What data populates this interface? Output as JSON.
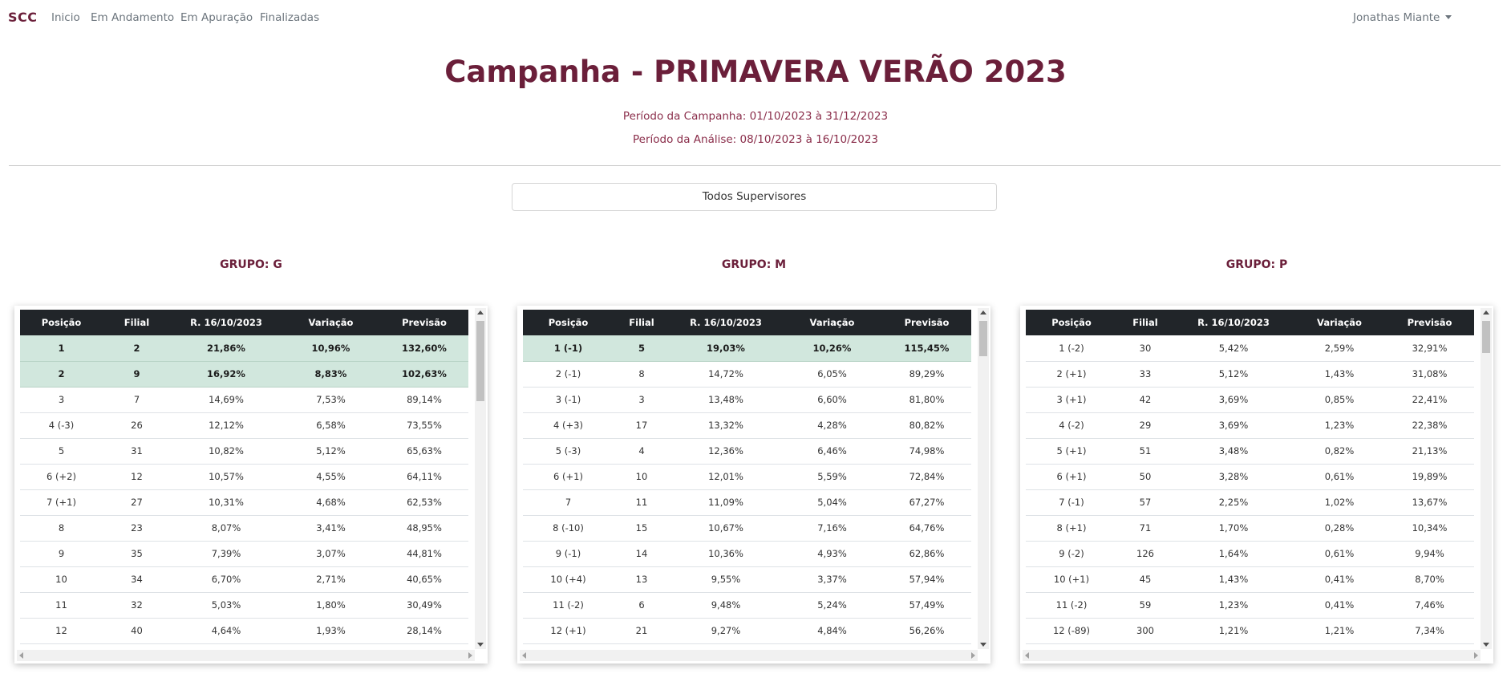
{
  "nav": {
    "brand": "SCC",
    "links": [
      "Inicio",
      "Em Andamento",
      "Em Apuração",
      "Finalizadas"
    ],
    "user": "Jonathas Miante"
  },
  "header": {
    "title": "Campanha - PRIMAVERA VERÃO 2023",
    "campaign_period": "Período da Campanha: 01/10/2023 à 31/12/2023",
    "analysis_period": "Período da Análise: 08/10/2023 à 16/10/2023"
  },
  "supervisor_select": {
    "label": "Todos Supervisores"
  },
  "colors": {
    "brand": "#6b1f3a",
    "table_header": "#212529",
    "highlight_row": "#d1e7dd"
  },
  "columns": [
    "Posição",
    "Filial",
    "R. 16/10/2023",
    "Variação",
    "Previsão"
  ],
  "groups": [
    {
      "title": "GRUPO: G",
      "rows": [
        {
          "pos": "1",
          "filial": "2",
          "r": "21,86%",
          "var": "10,96%",
          "prev": "132,60%",
          "highlight": true
        },
        {
          "pos": "2",
          "filial": "9",
          "r": "16,92%",
          "var": "8,83%",
          "prev": "102,63%",
          "highlight": true
        },
        {
          "pos": "3",
          "filial": "7",
          "r": "14,69%",
          "var": "7,53%",
          "prev": "89,14%"
        },
        {
          "pos": "4 (-3)",
          "filial": "26",
          "r": "12,12%",
          "var": "6,58%",
          "prev": "73,55%"
        },
        {
          "pos": "5",
          "filial": "31",
          "r": "10,82%",
          "var": "5,12%",
          "prev": "65,63%"
        },
        {
          "pos": "6 (+2)",
          "filial": "12",
          "r": "10,57%",
          "var": "4,55%",
          "prev": "64,11%"
        },
        {
          "pos": "7 (+1)",
          "filial": "27",
          "r": "10,31%",
          "var": "4,68%",
          "prev": "62,53%"
        },
        {
          "pos": "8",
          "filial": "23",
          "r": "8,07%",
          "var": "3,41%",
          "prev": "48,95%"
        },
        {
          "pos": "9",
          "filial": "35",
          "r": "7,39%",
          "var": "3,07%",
          "prev": "44,81%"
        },
        {
          "pos": "10",
          "filial": "34",
          "r": "6,70%",
          "var": "2,71%",
          "prev": "40,65%"
        },
        {
          "pos": "11",
          "filial": "32",
          "r": "5,03%",
          "var": "1,80%",
          "prev": "30,49%"
        },
        {
          "pos": "12",
          "filial": "40",
          "r": "4,64%",
          "var": "1,93%",
          "prev": "28,14%"
        }
      ]
    },
    {
      "title": "GRUPO: M",
      "rows": [
        {
          "pos": "1 (-1)",
          "filial": "5",
          "r": "19,03%",
          "var": "10,26%",
          "prev": "115,45%",
          "highlight": true
        },
        {
          "pos": "2 (-1)",
          "filial": "8",
          "r": "14,72%",
          "var": "6,05%",
          "prev": "89,29%"
        },
        {
          "pos": "3 (-1)",
          "filial": "3",
          "r": "13,48%",
          "var": "6,60%",
          "prev": "81,80%"
        },
        {
          "pos": "4 (+3)",
          "filial": "17",
          "r": "13,32%",
          "var": "4,28%",
          "prev": "80,82%"
        },
        {
          "pos": "5 (-3)",
          "filial": "4",
          "r": "12,36%",
          "var": "6,46%",
          "prev": "74,98%"
        },
        {
          "pos": "6 (+1)",
          "filial": "10",
          "r": "12,01%",
          "var": "5,59%",
          "prev": "72,84%"
        },
        {
          "pos": "7",
          "filial": "11",
          "r": "11,09%",
          "var": "5,04%",
          "prev": "67,27%"
        },
        {
          "pos": "8 (-10)",
          "filial": "15",
          "r": "10,67%",
          "var": "7,16%",
          "prev": "64,76%"
        },
        {
          "pos": "9 (-1)",
          "filial": "14",
          "r": "10,36%",
          "var": "4,93%",
          "prev": "62,86%"
        },
        {
          "pos": "10 (+4)",
          "filial": "13",
          "r": "9,55%",
          "var": "3,37%",
          "prev": "57,94%"
        },
        {
          "pos": "11 (-2)",
          "filial": "6",
          "r": "9,48%",
          "var": "5,24%",
          "prev": "57,49%"
        },
        {
          "pos": "12 (+1)",
          "filial": "21",
          "r": "9,27%",
          "var": "4,84%",
          "prev": "56,26%"
        }
      ]
    },
    {
      "title": "GRUPO: P",
      "rows": [
        {
          "pos": "1 (-2)",
          "filial": "30",
          "r": "5,42%",
          "var": "2,59%",
          "prev": "32,91%"
        },
        {
          "pos": "2 (+1)",
          "filial": "33",
          "r": "5,12%",
          "var": "1,43%",
          "prev": "31,08%"
        },
        {
          "pos": "3 (+1)",
          "filial": "42",
          "r": "3,69%",
          "var": "0,85%",
          "prev": "22,41%"
        },
        {
          "pos": "4 (-2)",
          "filial": "29",
          "r": "3,69%",
          "var": "1,23%",
          "prev": "22,38%"
        },
        {
          "pos": "5 (+1)",
          "filial": "51",
          "r": "3,48%",
          "var": "0,82%",
          "prev": "21,13%"
        },
        {
          "pos": "6 (+1)",
          "filial": "50",
          "r": "3,28%",
          "var": "0,61%",
          "prev": "19,89%"
        },
        {
          "pos": "7 (-1)",
          "filial": "57",
          "r": "2,25%",
          "var": "1,02%",
          "prev": "13,67%"
        },
        {
          "pos": "8 (+1)",
          "filial": "71",
          "r": "1,70%",
          "var": "0,28%",
          "prev": "10,34%"
        },
        {
          "pos": "9 (-2)",
          "filial": "126",
          "r": "1,64%",
          "var": "0,61%",
          "prev": "9,94%"
        },
        {
          "pos": "10 (+1)",
          "filial": "45",
          "r": "1,43%",
          "var": "0,41%",
          "prev": "8,70%"
        },
        {
          "pos": "11 (-2)",
          "filial": "59",
          "r": "1,23%",
          "var": "0,41%",
          "prev": "7,46%"
        },
        {
          "pos": "12 (-89)",
          "filial": "300",
          "r": "1,21%",
          "var": "1,21%",
          "prev": "7,34%"
        }
      ]
    }
  ]
}
